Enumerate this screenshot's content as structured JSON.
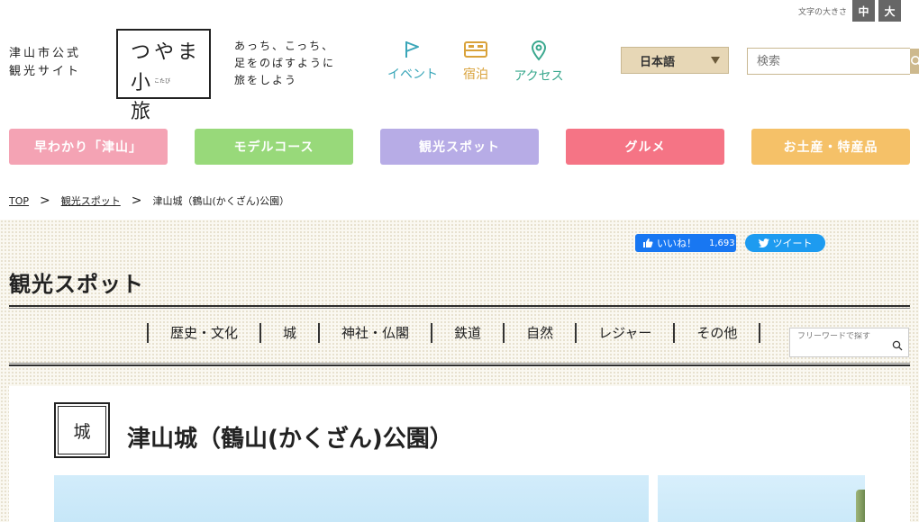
{
  "fontsize": {
    "label": "文字の大きさ",
    "medium": "中",
    "large": "大"
  },
  "logo": {
    "sub_line1": "津山市公式",
    "sub_line2": "観光サイト",
    "title_line1": "つやま",
    "title_line2": "小旅",
    "ruby": "こたび",
    "catch_line1": "あっち、こっち、",
    "catch_line2": "足をのばすように",
    "catch_line3": "旅をしよう"
  },
  "nav": {
    "event": "イベント",
    "stay": "宿泊",
    "access": "アクセス"
  },
  "language": {
    "selected": "日本語"
  },
  "search": {
    "placeholder": "検索"
  },
  "categories": [
    {
      "label": "早わかり「津山」",
      "color": "#f4a3b4"
    },
    {
      "label": "モデルコース",
      "color": "#98d97a"
    },
    {
      "label": "観光スポット",
      "color": "#b7ace6"
    },
    {
      "label": "グルメ",
      "color": "#f57485"
    },
    {
      "label": "お土産・特産品",
      "color": "#f5c168"
    }
  ],
  "breadcrumb": {
    "top": "TOP",
    "spots": "観光スポット",
    "current": "津山城（鶴山(かくざん)公園）",
    "sep": ">"
  },
  "social": {
    "like": "いいね！",
    "like_count": "1,693",
    "tweet": "ツイート"
  },
  "section": {
    "title": "観光スポット",
    "subnav": [
      "歴史・文化",
      "城",
      "神社・仏閣",
      "鉄道",
      "自然",
      "レジャー",
      "その他"
    ],
    "freeword_placeholder": "フリーワードで探す"
  },
  "spot": {
    "tag": "城",
    "title": "津山城（鶴山(かくざん)公園）"
  }
}
